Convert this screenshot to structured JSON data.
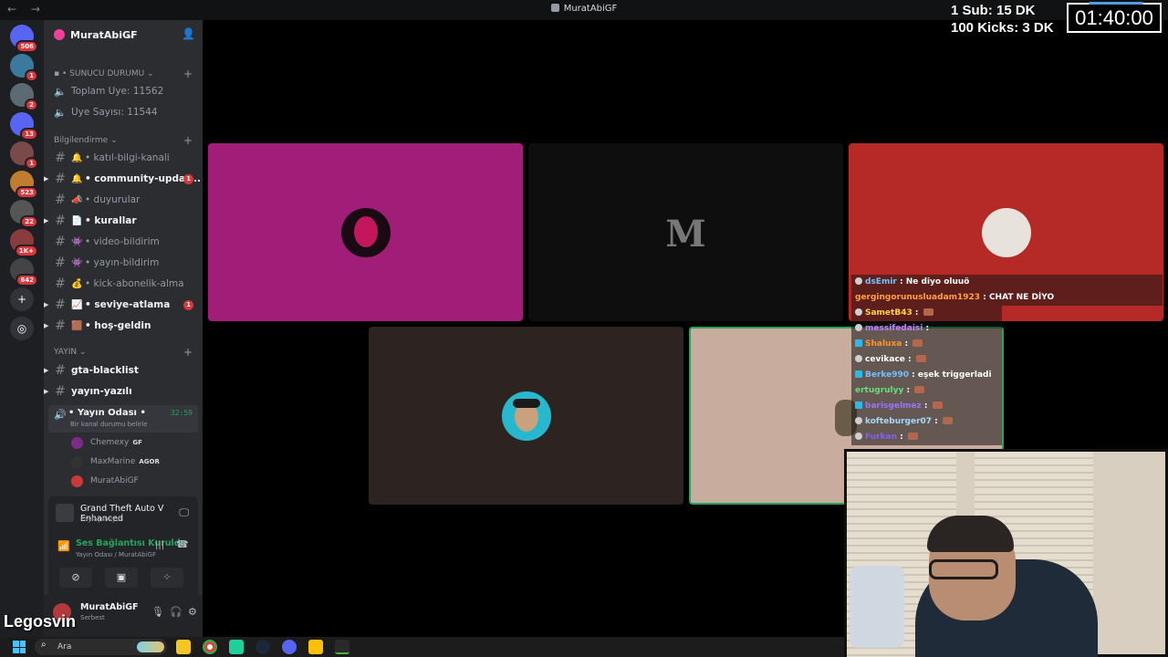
{
  "window": {
    "title": "MuratAbiGF"
  },
  "server": {
    "name": "MuratAbiGF"
  },
  "rail": [
    {
      "name": "discord-home",
      "badge": "506",
      "color": "#5865f2"
    },
    {
      "name": "server-1",
      "badge": "1",
      "color": "#3b7a9e"
    },
    {
      "name": "server-2",
      "badge": "2",
      "color": "#5c6a73"
    },
    {
      "name": "server-3",
      "badge": "13",
      "color": "#5865f2"
    },
    {
      "name": "server-4",
      "badge": "1",
      "color": "#7a4a4a"
    },
    {
      "name": "server-5",
      "badge": "523",
      "color": "#c27c2e"
    },
    {
      "name": "server-6",
      "badge": "22",
      "color": "#555"
    },
    {
      "name": "server-7",
      "badge": "1K+",
      "color": "#8a3b3b"
    },
    {
      "name": "server-8",
      "badge": "642",
      "color": "#444"
    }
  ],
  "categories": {
    "sunucu": "SUNUCU DURUMU",
    "bilgi": "Bilgilendirme",
    "yayin": "YAYIN"
  },
  "stats": {
    "members": "Toplam Üye: 11562",
    "count": "Üye Sayısı: 11544"
  },
  "channels": [
    {
      "label": "katıl-bilgi-kanali",
      "emoji": "🔔",
      "bold": false,
      "badge": ""
    },
    {
      "label": "community-updat...",
      "emoji": "🔔",
      "bold": true,
      "badge": "1"
    },
    {
      "label": "duyurular",
      "emoji": "📣",
      "bold": false,
      "badge": ""
    },
    {
      "label": "kurallar",
      "emoji": "📄",
      "bold": true,
      "badge": ""
    },
    {
      "label": "video-bildirim",
      "emoji": "👾",
      "bold": false,
      "badge": ""
    },
    {
      "label": "yayın-bildirim",
      "emoji": "👾",
      "bold": false,
      "badge": ""
    },
    {
      "label": "kick-abonelik-alma",
      "emoji": "💰",
      "bold": false,
      "badge": ""
    },
    {
      "label": "seviye-atlama",
      "emoji": "📈",
      "bold": true,
      "badge": "1"
    },
    {
      "label": "hoş-geldin",
      "emoji": "🟫",
      "bold": true,
      "badge": ""
    }
  ],
  "yayin_channels": [
    {
      "label": "gta-blacklist"
    },
    {
      "label": "yayın-yazılı"
    }
  ],
  "voice": {
    "name": "Yayın Odası",
    "status": "Bir kanal durumu belirle",
    "time": "32:59",
    "users": [
      {
        "name": "Chemexy",
        "tag": "GF",
        "color": "#7b2c8a"
      },
      {
        "name": "MaxMarine",
        "tag": "AGOR",
        "color": "#333"
      },
      {
        "name": "MuratAbiGF",
        "tag": "",
        "color": "#c93a3a"
      }
    ]
  },
  "activity": {
    "game": "Grand Theft Auto V Enhanced",
    "sub": "Paylaşılmıyor"
  },
  "connection": {
    "status": "Ses Bağlantısı Kuruldu",
    "location": "Yayın Odası / MuratAbiGF"
  },
  "user": {
    "name": "MuratAbiGF",
    "status": "Serbest"
  },
  "hud": {
    "line1": "1 Sub: 15 DK",
    "line2": "100 Kicks: 3 DK",
    "timer": "01:40:00"
  },
  "tiles": [
    {
      "name": "tile-pink",
      "bg": "#a01e78",
      "avatar": "#c2185b"
    },
    {
      "name": "tile-m",
      "bg": "#0e0e0e",
      "letter": "M"
    },
    {
      "name": "tile-red",
      "bg": "#b52a27",
      "avatar": "#e8e2dc"
    },
    {
      "name": "tile-brown",
      "bg": "#2d2421",
      "avatar": "#27b8cf"
    },
    {
      "name": "tile-beige",
      "bg": "#c8ac9e",
      "avatar": "#6b5c4a"
    }
  ],
  "chat": [
    {
      "user": "dsEmir",
      "color": "#6ec6ff",
      "msg": "Ne diyo oluuö",
      "wide": true,
      "icon": "c"
    },
    {
      "user": "gergingorunusluadam1923",
      "color": "#ff9f43",
      "msg": "CHAT NE DİYO",
      "wide": true,
      "icon": ""
    },
    {
      "user": "SametB43",
      "color": "#ffd43b",
      "msg": "",
      "emote": true,
      "icon": "c"
    },
    {
      "user": "messifedaisi",
      "color": "#c77dff",
      "msg": "",
      "emote": false,
      "icon": "c"
    },
    {
      "user": "Shaluxa",
      "color": "#ff922b",
      "msg": "",
      "emote": true,
      "icon": "b"
    },
    {
      "user": "cevikace",
      "color": "#ffffff",
      "msg": "",
      "emote": true,
      "icon": "c"
    },
    {
      "user": "Berke990",
      "color": "#74c0fc",
      "msg": "eşek triggerladi",
      "emote": false,
      "icon": "b"
    },
    {
      "user": "ertugrulyy",
      "color": "#69db7c",
      "msg": "",
      "emote": true,
      "icon": ""
    },
    {
      "user": "barisgelmez",
      "color": "#9775fa",
      "msg": "",
      "emote": true,
      "icon": "b"
    },
    {
      "user": "kofteburger07",
      "color": "#a5d8ff",
      "msg": "",
      "emote": true,
      "icon": "c"
    },
    {
      "user": "Furkan",
      "color": "#845ef7",
      "msg": "",
      "emote": true,
      "icon": "c"
    }
  ],
  "overlay_name": "Legosvin",
  "taskbar": {
    "search_placeholder": "Ara"
  }
}
